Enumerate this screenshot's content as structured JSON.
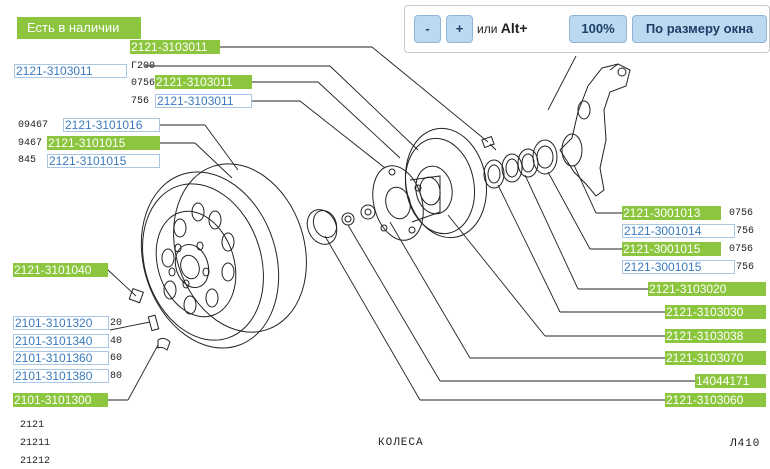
{
  "badge": {
    "text": "Есть в наличии"
  },
  "toolbar": {
    "zoom_out": "-",
    "zoom_in": "+",
    "alt_hint_prefix": "или",
    "alt_hint_key": "Alt+",
    "zoom_level": "100%",
    "fit_window": "По размеру окна",
    "icon": "mouse-icon"
  },
  "caption": "КОЛЕСА",
  "figure_code": "Л410",
  "model_codes": [
    "2121",
    "21211",
    "21212"
  ],
  "qty_labels": {
    "g200": "Г200",
    "q0756": "0756",
    "q756": "756",
    "q09467": "09467",
    "q9467": "9467",
    "q845": "845",
    "r0756a": "0756",
    "r756a": "756",
    "r0756b": "0756",
    "r756b": "756",
    "q20": "20",
    "q40": "40",
    "q60": "60",
    "q80": "80"
  },
  "part_links": {
    "p01": "2121-3103011",
    "p02": "2121-3103011",
    "p03": "2121-3103011",
    "p04": "2121-3103011",
    "p05": "2121-3101016",
    "p06": "2121-3101015",
    "p07": "2121-3101015",
    "p08": "2121-3101040",
    "p09": "2101-3101320",
    "p10": "2101-3101340",
    "p11": "2101-3101360",
    "p12": "2101-3101380",
    "p13": "2101-3101300",
    "p14": "2121-3001013",
    "p15": "2121-3001014",
    "p16": "2121-3001015",
    "p17": "2121-3001015",
    "p18": "2121-3103020",
    "p19": "2121-3103030",
    "p20": "2121-3103038",
    "p21": "2121-3103070",
    "p22": "14044171",
    "p23": "2121-3103060"
  }
}
